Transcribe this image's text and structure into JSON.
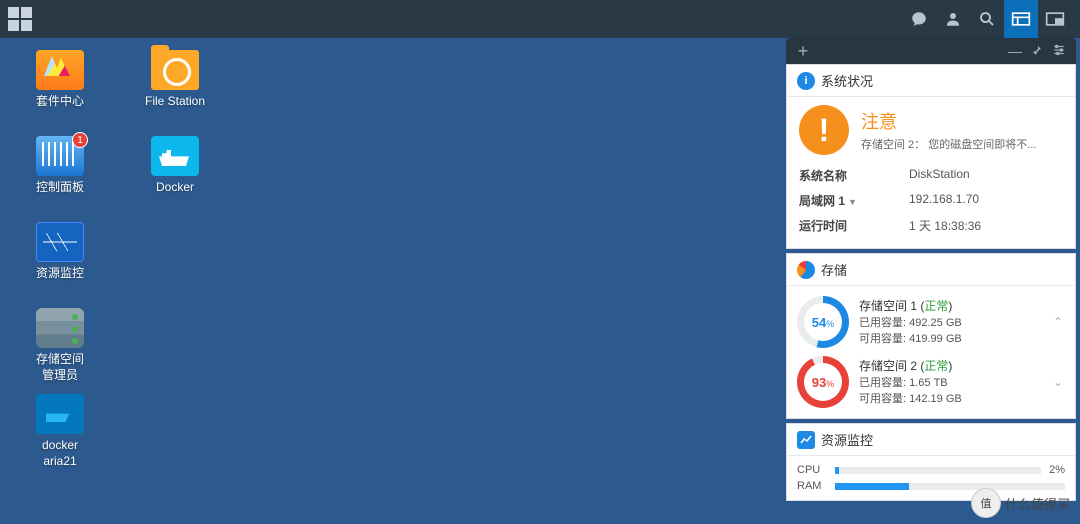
{
  "desktop": {
    "icons": [
      {
        "label": "套件中心",
        "badge": null
      },
      {
        "label": "File Station",
        "badge": null
      },
      {
        "label": "控制面板",
        "badge": "1"
      },
      {
        "label": "Docker",
        "badge": null
      },
      {
        "label": "资源监控",
        "badge": null
      },
      {
        "label": "",
        "badge": null
      },
      {
        "label": "存储空间\n管理员",
        "badge": null
      },
      {
        "label": "",
        "badge": null
      },
      {
        "label": "docker\naria21",
        "badge": null
      }
    ]
  },
  "widgets": {
    "health": {
      "title": "系统状况",
      "alert_title": "注意",
      "alert_sub": "存储空间 2：  您的磁盘空间即将不...",
      "rows": [
        {
          "k": "系统名称",
          "v": "DiskStation"
        },
        {
          "k": "局域网 1",
          "v": "192.168.1.70",
          "dropdown": true
        },
        {
          "k": "运行时间",
          "v": "1 天 18:38:36"
        }
      ]
    },
    "storage": {
      "title": "存储",
      "volumes": [
        {
          "pct": 54,
          "color": "#1e88e5",
          "name": "存储空间 1",
          "status": "正常",
          "used_label": "已用容量:",
          "used": "492.25 GB",
          "avail_label": "可用容量:",
          "avail": "419.99 GB"
        },
        {
          "pct": 93,
          "color": "#e8413a",
          "name": "存储空间 2",
          "status": "正常",
          "used_label": "已用容量:",
          "used": "1.65 TB",
          "avail_label": "可用容量:",
          "avail": "142.19 GB"
        }
      ]
    },
    "resource": {
      "title": "资源监控",
      "cpu_label": "CPU",
      "cpu_val": "2%",
      "cpu_pct": 2,
      "ram_label": "RAM",
      "ram_pct": 32
    }
  },
  "watermark": {
    "text": "什么值得买"
  }
}
